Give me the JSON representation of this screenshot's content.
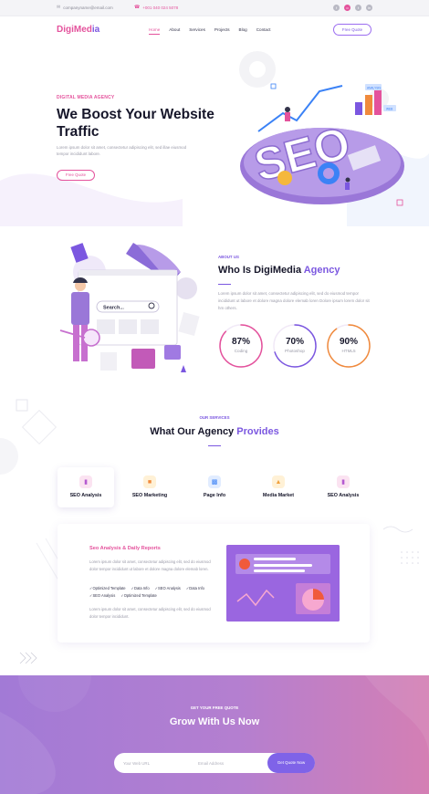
{
  "topbar": {
    "email": "companyname@email.com",
    "phone": "+001 040 024 5078",
    "socials": [
      "facebook-icon",
      "instagram-icon",
      "twitter-icon",
      "linkedin-icon"
    ]
  },
  "nav": {
    "logo": "DigiMedia",
    "items": [
      "Home",
      "About",
      "Services",
      "Projects",
      "Blog",
      "Contact"
    ],
    "active": "Home",
    "quote_button": "Free Quote"
  },
  "hero": {
    "tag": "DIGITAL MEDIA AGENCY",
    "title": "We Boost Your Website Traffic",
    "description": "Lorem ipsum dolor sit amet, consectetur adipiscing elit, sed illae eiusmod tempor incididunt labore.",
    "button": "Free Quote",
    "art_labels": [
      "SEO",
      "ANALYSIS",
      "WEB"
    ]
  },
  "about": {
    "tag": "ABOUT US",
    "title_main": "Who Is DigiMedia ",
    "title_accent": "Agency",
    "description": "Lorem ipsum dolor sit amet, consectetur adipiscing elit, sed do eiusmod tempor incididunt ut labore et dolore magna dolore elemab loren Dolore ipsum lorem dolor sit hm others.",
    "search_label": "Search...",
    "stats": [
      {
        "value": "87%",
        "label": "Coding",
        "percent": 87,
        "color": "#e4529c"
      },
      {
        "value": "70%",
        "label": "Photoshop",
        "percent": 70,
        "color": "#7b57e0"
      },
      {
        "value": "90%",
        "label": "HTML5",
        "percent": 90,
        "color": "#f08a3c"
      }
    ]
  },
  "services": {
    "tag": "OUR SERVICES",
    "title_main": "What Our Agency ",
    "title_accent": "Provides",
    "items": [
      {
        "label": "SEO Analysis",
        "icon": "chart-icon",
        "color": "#fbe3f1",
        "glyph_color": "#b45ad0"
      },
      {
        "label": "SEO Marketing",
        "icon": "marketing-icon",
        "color": "#fff1d6",
        "glyph_color": "#f08a3c"
      },
      {
        "label": "Page Info",
        "icon": "page-icon",
        "color": "#e1ecff",
        "glyph_color": "#3b82f6"
      },
      {
        "label": "Media Market",
        "icon": "media-icon",
        "color": "#fff1d6",
        "glyph_color": "#f0a03c"
      },
      {
        "label": "SEO Analysis",
        "icon": "chart-icon",
        "color": "#fbe3f1",
        "glyph_color": "#b45ad0"
      }
    ],
    "detail": {
      "title": "Seo Analysis & Daily Reports",
      "description": "Lorem ipsum dolor sit amet, consectetur adipiscing elit, sed do eiusmod dolor tempor incididunt ut labore et dolore magna dolore elemab loren.",
      "checks": [
        "Optimized Template",
        "Data Info",
        "SEO Analysis",
        "Data Info",
        "SEO Analysis",
        "Optimized Template"
      ],
      "description2": "Lorem ipsum dolor sit amet, consectetur adipiscing elit, sed do eiusmod dolor tempor incididunt."
    }
  },
  "cta": {
    "tag": "GET YOUR FREE QUOTE",
    "title": "Grow With Us Now",
    "url_placeholder": "Your Web URL",
    "email_placeholder": "Email Address",
    "button": "Get Quote Now"
  }
}
